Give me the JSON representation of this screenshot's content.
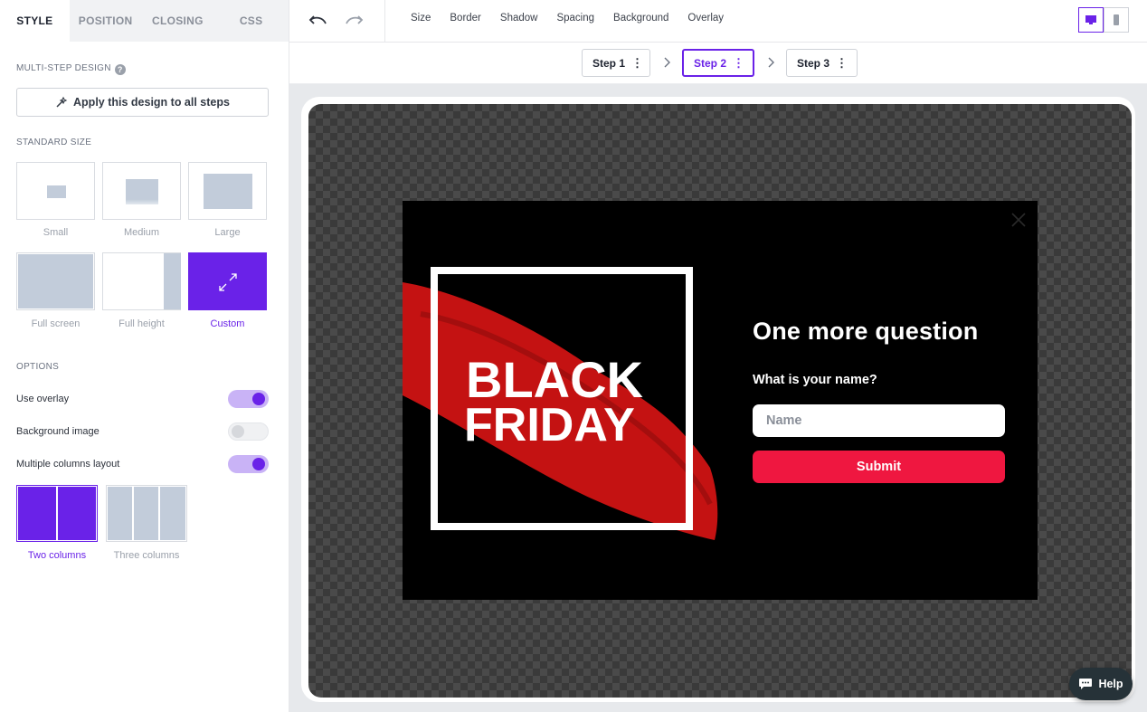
{
  "tabs": [
    "STYLE",
    "POSITION",
    "CLOSING",
    "CSS"
  ],
  "multistep": {
    "label": "MULTI-STEP DESIGN",
    "help": "?",
    "apply_label": "Apply this design to all steps"
  },
  "standard_size": {
    "label": "STANDARD SIZE",
    "options": [
      "Small",
      "Medium",
      "Large",
      "Full screen",
      "Full height",
      "Custom"
    ],
    "selected": "Custom"
  },
  "options": {
    "label": "OPTIONS",
    "use_overlay": {
      "label": "Use overlay",
      "on": true
    },
    "background_image": {
      "label": "Background image",
      "on": false
    },
    "multiple_columns": {
      "label": "Multiple columns layout",
      "on": true
    }
  },
  "columns": {
    "options": [
      "Two columns",
      "Three columns"
    ],
    "selected": "Two columns"
  },
  "toolbar": {
    "menu": [
      "Size",
      "Border",
      "Shadow",
      "Spacing",
      "Background",
      "Overlay"
    ]
  },
  "steps": {
    "items": [
      "Step 1",
      "Step 2",
      "Step 3"
    ],
    "selected": "Step 2",
    "menu_glyph": "⋮"
  },
  "popup": {
    "image_text_line1": "BLACK",
    "image_text_line2": "FRIDAY",
    "title": "One more question",
    "question": "What is your name?",
    "input_placeholder": "Name",
    "submit_label": "Submit"
  },
  "help_button": "Help",
  "colors": {
    "accent": "#6a22e8",
    "submit": "#ef1740",
    "popup_bg": "#000000"
  }
}
